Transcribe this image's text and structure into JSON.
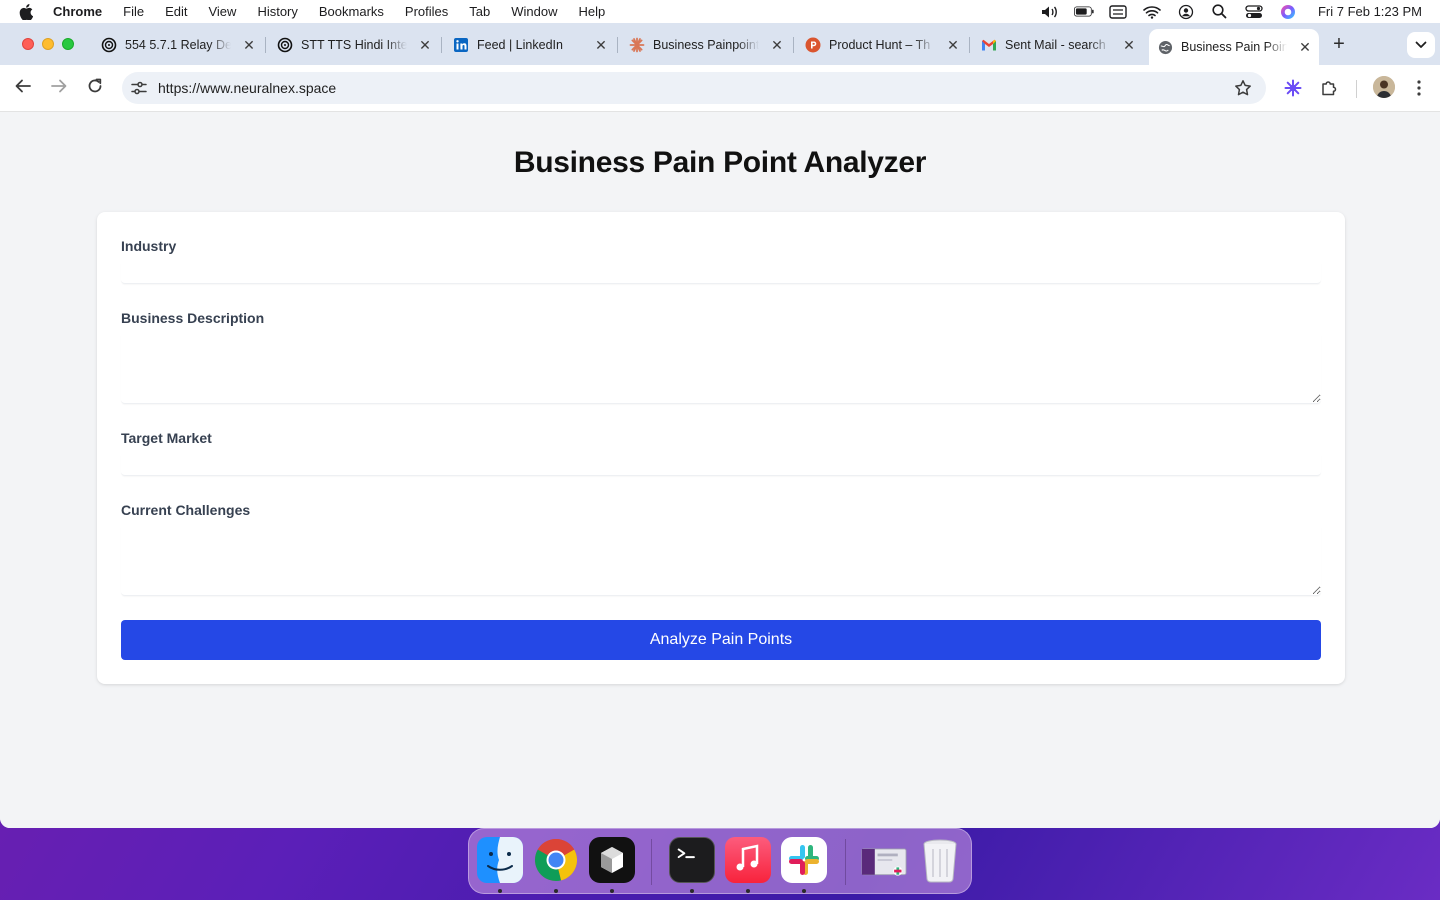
{
  "menubar": {
    "app_name": "Chrome",
    "items": [
      "File",
      "Edit",
      "View",
      "History",
      "Bookmarks",
      "Profiles",
      "Tab",
      "Window",
      "Help"
    ],
    "clock": "Fri 7 Feb  1:23 PM"
  },
  "tabs": [
    {
      "title": "554 5.7.1 Relay De",
      "icon": "openai-icon"
    },
    {
      "title": "STT TTS Hindi Inte",
      "icon": "openai-icon"
    },
    {
      "title": "Feed | LinkedIn",
      "icon": "linkedin-icon"
    },
    {
      "title": "Business Painpoint",
      "icon": "claude-icon"
    },
    {
      "title": "Product Hunt – Th",
      "icon": "product-hunt-icon"
    },
    {
      "title": "Sent Mail - search",
      "icon": "gmail-icon"
    },
    {
      "title": "Business Pain Poin",
      "icon": "globe-icon",
      "active": true
    }
  ],
  "toolbar": {
    "url": "https://www.neuralnex.space"
  },
  "page": {
    "title": "Business Pain Point Analyzer",
    "fields": {
      "industry_label": "Industry",
      "industry_value": "",
      "description_label": "Business Description",
      "description_value": "",
      "target_label": "Target Market",
      "target_value": "",
      "challenges_label": "Current Challenges",
      "challenges_value": ""
    },
    "submit_label": "Analyze Pain Points"
  },
  "colors": {
    "accent": "#2548e6",
    "page_bg": "#f3f4f6",
    "tabstrip_bg": "#dbe3f0"
  },
  "dock": {
    "apps": [
      "finder-icon",
      "chrome-icon",
      "cube-app-icon",
      "terminal-icon",
      "music-icon",
      "slack-icon",
      "window-preview-icon",
      "trash-icon"
    ]
  }
}
